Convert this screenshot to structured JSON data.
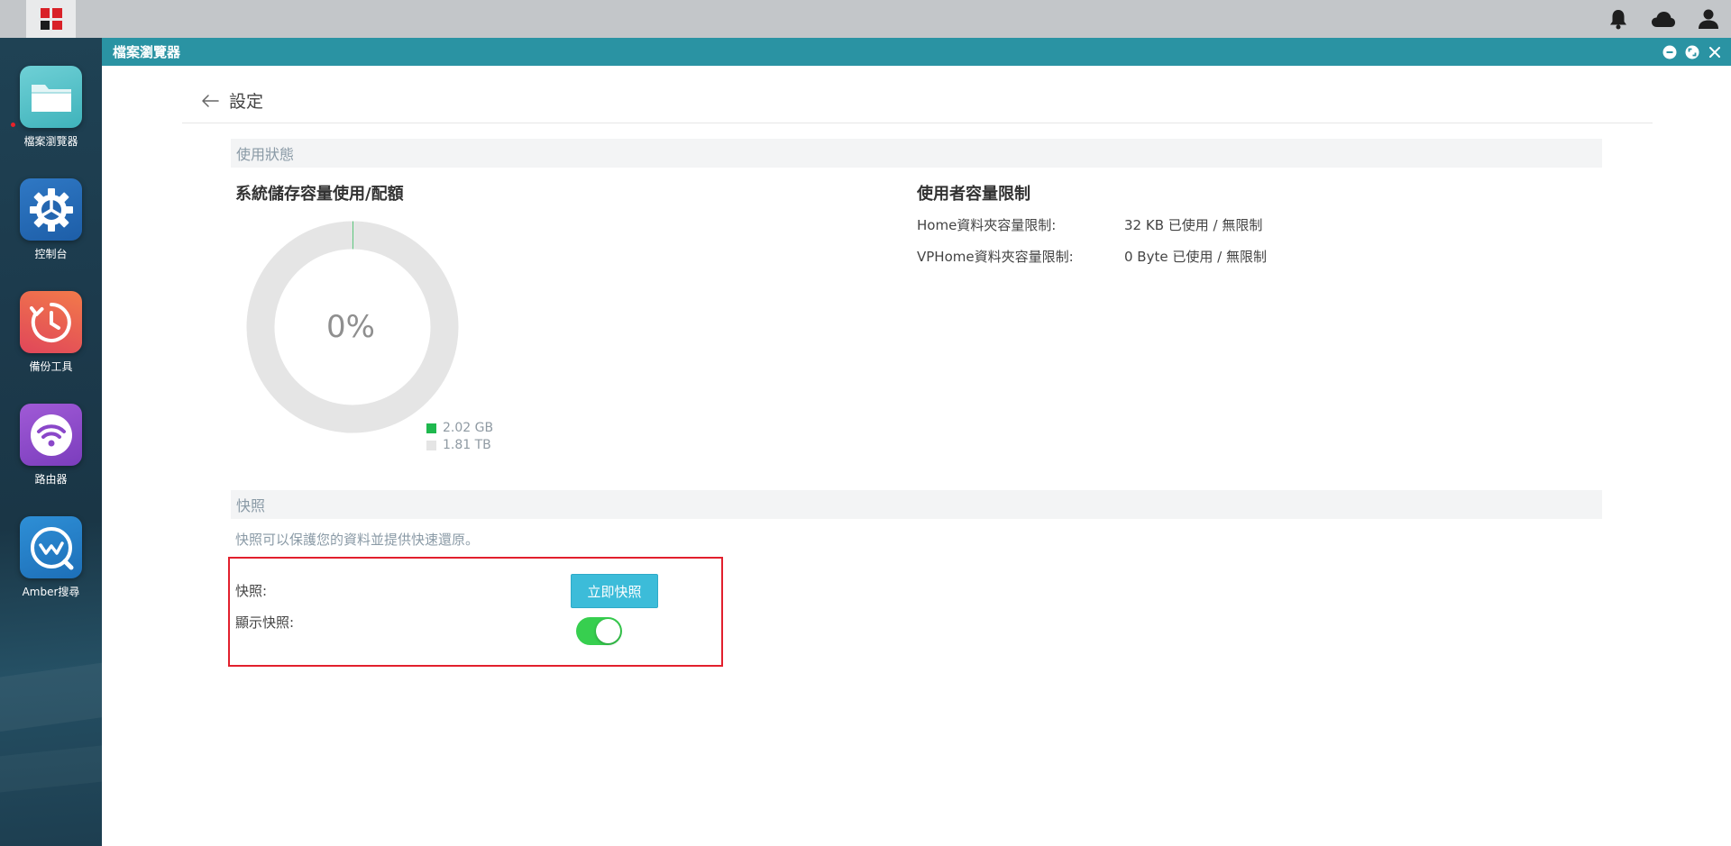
{
  "colors": {
    "accent": "#2a93a3",
    "used": "#1fb84e",
    "free": "#e5e5e5",
    "toggle_on": "#37cf4f",
    "button": "#3cbcd9",
    "highlight": "#e2202d"
  },
  "desktop": {
    "start_icon": "grid-start-icon",
    "tray": [
      "bell-icon",
      "cloud-icon",
      "user-icon"
    ]
  },
  "dock": {
    "apps": [
      {
        "label": "檔案瀏覽器",
        "icon": "folder-icon",
        "running": true
      },
      {
        "label": "控制台",
        "icon": "gear-icon",
        "running": false
      },
      {
        "label": "備份工具",
        "icon": "clock-backup-icon",
        "running": false
      },
      {
        "label": "路由器",
        "icon": "wifi-icon",
        "running": false
      },
      {
        "label": "Amber搜尋",
        "icon": "amber-search-icon",
        "running": false
      }
    ]
  },
  "window": {
    "title": "檔案瀏覽器",
    "controls": [
      "minimize-icon",
      "maximize-icon",
      "close-icon"
    ]
  },
  "settings": {
    "title": "設定",
    "usage_section": "使用狀態",
    "storage": {
      "title": "系統儲存容量使用/配額",
      "percent_label": "0%",
      "used_fraction": 0.0011,
      "used_label": "2.02 GB",
      "total_label": "1.81 TB"
    },
    "quota": {
      "title": "使用者容量限制",
      "rows": [
        {
          "label": "Home資料夾容量限制:",
          "value": "32 KB 已使用 / 無限制"
        },
        {
          "label": "VPHome資料夾容量限制:",
          "value": "0 Byte 已使用 / 無限制"
        }
      ]
    },
    "snapshot": {
      "section": "快照",
      "description": "快照可以保護您的資料並提供快速還原。",
      "snapshot_label": "快照:",
      "snapshot_button": "立即快照",
      "show_label": "顯示快照:",
      "show_enabled": true
    }
  }
}
